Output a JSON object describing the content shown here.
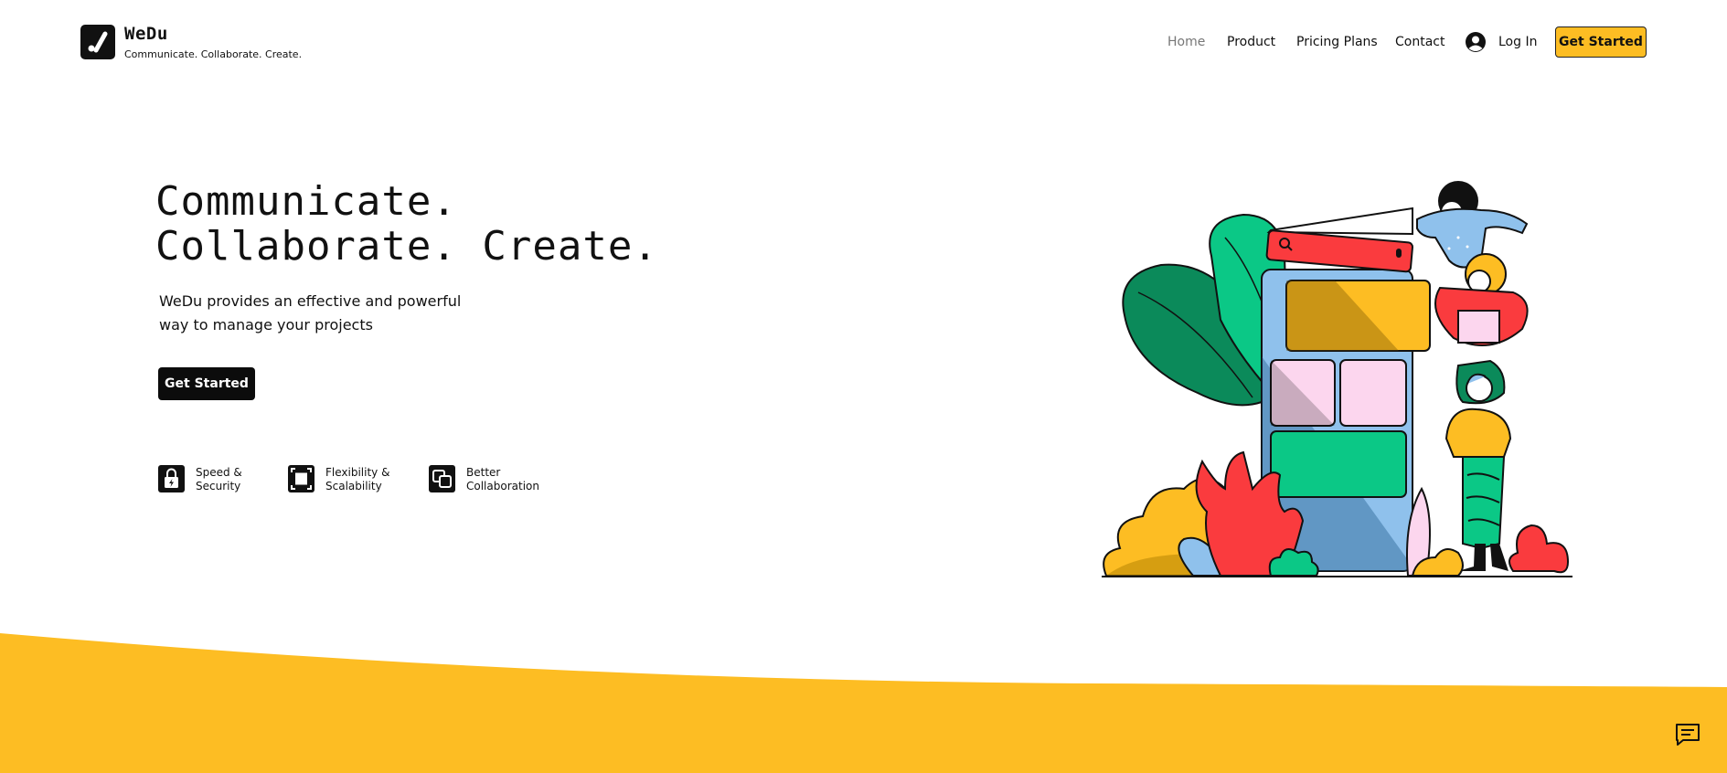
{
  "brand": {
    "name": "WeDu",
    "tagline": "Communicate. Collaborate. Create.",
    "logo_icon": "checkmark-logo-icon"
  },
  "nav": {
    "items": [
      {
        "label": "Home",
        "active": true
      },
      {
        "label": "Product"
      },
      {
        "label": "Pricing Plans"
      },
      {
        "label": "Contact"
      }
    ],
    "login_label": "Log In",
    "login_icon": "user-avatar-icon",
    "cta_label": "Get Started"
  },
  "hero": {
    "title_line1": "Communicate.",
    "title_line2": "Collaborate. Create.",
    "subtitle_line1": "WeDu provides an effective and powerful",
    "subtitle_line2": "way to manage your projects",
    "cta_label": "Get Started"
  },
  "features": [
    {
      "line1": "Speed &",
      "line2": "Security",
      "icon": "lock-bolt-icon"
    },
    {
      "line1": "Flexibility &",
      "line2": "Scalability",
      "icon": "expand-square-icon"
    },
    {
      "line1": "Better",
      "line2": "Collaboration",
      "icon": "overlap-squares-icon"
    }
  ],
  "chat_icon": "chat-bubble-icon",
  "colors": {
    "accent": "#fdbd23",
    "dark": "#0c0c0c",
    "green": "#0bc886",
    "dark_green": "#0b8a5a",
    "red": "#fa3b3e",
    "pink": "#fcd6ee",
    "blue": "#8fc1ec"
  }
}
